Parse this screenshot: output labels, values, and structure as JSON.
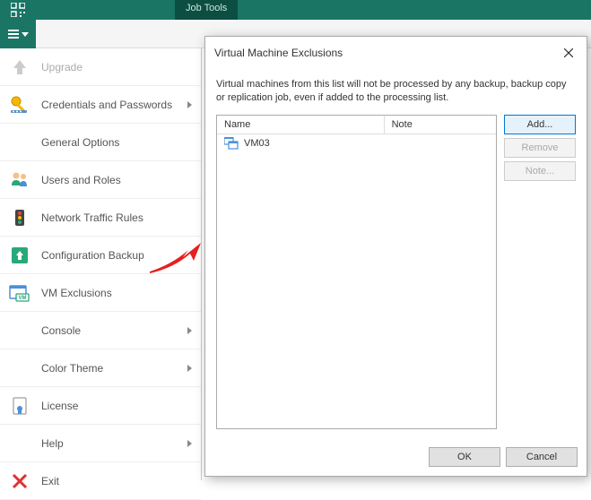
{
  "ribbon": {
    "tab_label": "Job Tools"
  },
  "menu": {
    "items": [
      {
        "label": "Upgrade",
        "disabled": true
      },
      {
        "label": "Credentials and Passwords",
        "arrow": true
      },
      {
        "label": "General Options"
      },
      {
        "label": "Users and Roles"
      },
      {
        "label": "Network Traffic Rules"
      },
      {
        "label": "Configuration Backup"
      },
      {
        "label": "VM Exclusions"
      },
      {
        "label": "Console",
        "arrow": true
      },
      {
        "label": "Color Theme",
        "arrow": true
      },
      {
        "label": "License"
      },
      {
        "label": "Help",
        "arrow": true
      },
      {
        "label": "Exit"
      }
    ]
  },
  "dialog": {
    "title": "Virtual Machine Exclusions",
    "description": "Virtual machines from this list will not be processed by any backup, backup copy or replication job, even if added to the processing list.",
    "columns": {
      "name": "Name",
      "note": "Note"
    },
    "rows": [
      {
        "name": "VM03",
        "note": ""
      }
    ],
    "buttons": {
      "add": "Add...",
      "remove": "Remove",
      "note": "Note...",
      "ok": "OK",
      "cancel": "Cancel"
    }
  }
}
